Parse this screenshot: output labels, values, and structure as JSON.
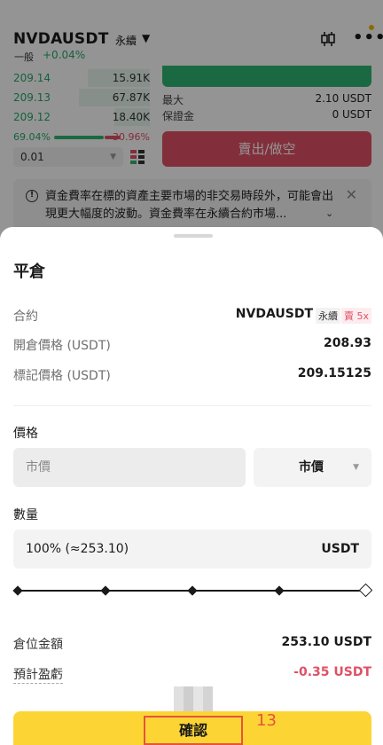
{
  "header": {
    "pair": "NVDAUSDT",
    "pair_type": "永續",
    "sub_label": "一般",
    "change": "+0.04%"
  },
  "orderbook": {
    "rows": [
      {
        "price": "209.14",
        "qty": "15.91K"
      },
      {
        "price": "209.13",
        "qty": "67.87K"
      },
      {
        "price": "209.12",
        "qty": "18.40K"
      }
    ],
    "buy_ratio": "69.04%",
    "sell_ratio": "30.96%",
    "depth": "0.01"
  },
  "trade_panel": {
    "max_label": "最大",
    "max_value": "2.10 USDT",
    "margin_label": "保證金",
    "margin_value": "0 USDT",
    "sell_button": "賣出/做空"
  },
  "notice": {
    "text": "資金費率在標的資產主要市場的非交易時段外，可能會出現更大幅度的波動。資金費率在永續合約市場..."
  },
  "sheet": {
    "title": "平倉",
    "contract_label": "合約",
    "contract_value": "NVDAUSDT",
    "contract_type": "永續",
    "leverage": "賣 5x",
    "open_price_label": "開倉價格 (USDT)",
    "open_price_value": "208.93",
    "mark_price_label": "標記價格 (USDT)",
    "mark_price_value": "209.15125",
    "price_label": "價格",
    "price_placeholder": "市價",
    "price_type": "市價",
    "qty_label": "數量",
    "qty_value": "100% (≈253.10)",
    "qty_unit": "USDT",
    "slider_percent": 100,
    "position_value_label": "倉位金額",
    "position_value": "253.10 USDT",
    "est_pnl_label": "預計盈虧",
    "est_pnl_value": "-0.35 USDT",
    "confirm_button": "確認",
    "annotation_number": "13"
  },
  "colors": {
    "green": "#27a869",
    "red": "#e05166",
    "confirm_yellow": "#fcd535",
    "annotation_red": "#e5533d"
  }
}
